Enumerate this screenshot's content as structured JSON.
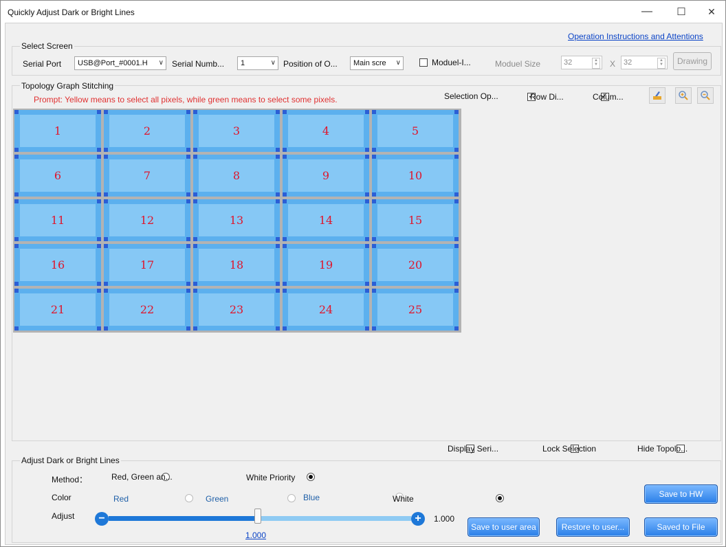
{
  "window": {
    "title": "Quickly Adjust Dark or Bright Lines",
    "minimize": "—",
    "maximize": "☐",
    "close": "✕"
  },
  "instructions_link": "Operation Instructions and Attentions",
  "select_screen": {
    "group_label": "Select Screen",
    "serial_port_label": "Serial Port",
    "serial_port_value": "USB@Port_#0001.H",
    "serial_number_label": "Serial Numb...",
    "serial_number_value": "1",
    "position_label": "Position of O...",
    "position_value": "Main scre",
    "module_checkbox_label": "Moduel-I...",
    "module_size_label": "Moduel Size",
    "module_width": "32",
    "module_x": "X",
    "module_height": "32",
    "drawing_button": "Drawing"
  },
  "topology": {
    "group_label": "Topology Graph Stitching",
    "prompt": "Prompt: Yellow means to select all pixels, while green means to select some pixels.",
    "selection_label": "Selection Op...",
    "row_checkbox_label": "Row Di...",
    "column_checkbox_label": "Colum...",
    "tools": [
      "brush-icon",
      "zoom-in-icon",
      "zoom-out-icon"
    ],
    "cells": [
      "1",
      "2",
      "3",
      "4",
      "5",
      "6",
      "7",
      "8",
      "9",
      "10",
      "11",
      "12",
      "13",
      "14",
      "15",
      "16",
      "17",
      "18",
      "19",
      "20",
      "21",
      "22",
      "23",
      "24",
      "25"
    ],
    "display_serial_label": "Display Seri...",
    "lock_selection_label": "Lock Selection",
    "hide_topology_label": "Hide Topolo..."
  },
  "adjust": {
    "group_label": "Adjust Dark or Bright Lines",
    "method_label": "Method：",
    "method_options": [
      "Red, Green an...",
      "White Priority"
    ],
    "method_selected": "White Priority",
    "color_label": "Color",
    "color_options": [
      "Red",
      "Green",
      "Blue",
      "White"
    ],
    "color_selected": "White",
    "adjust_label": "Adjust",
    "slider_value": 1.0,
    "slider_value_text": "1.000",
    "slider_max_text": "1.000",
    "buttons": {
      "save_to_user_area": "Save to user area",
      "restore_to_user": "Restore to user...",
      "save_to_hw": "Save to HW",
      "saved_to_file": "Saved to File"
    }
  },
  "colors": {
    "accent_blue": "#1e78d8",
    "cell_fill": "#86c8f5",
    "cell_number": "#e0142a",
    "prompt_red": "#e03030",
    "link_blue": "#0a43c6"
  }
}
